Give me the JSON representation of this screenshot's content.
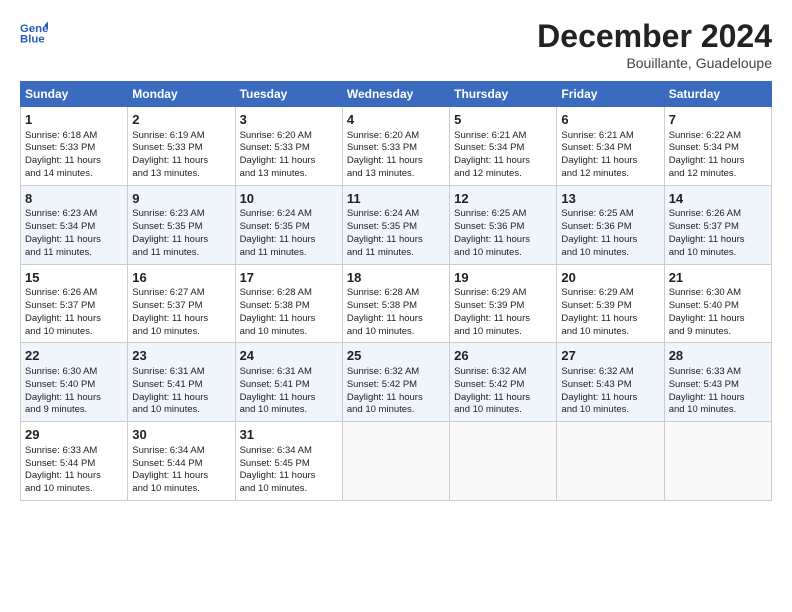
{
  "logo": {
    "line1": "General",
    "line2": "Blue"
  },
  "title": "December 2024",
  "subtitle": "Bouillante, Guadeloupe",
  "days_of_week": [
    "Sunday",
    "Monday",
    "Tuesday",
    "Wednesday",
    "Thursday",
    "Friday",
    "Saturday"
  ],
  "weeks": [
    [
      {
        "day": "1",
        "lines": [
          "Sunrise: 6:18 AM",
          "Sunset: 5:33 PM",
          "Daylight: 11 hours",
          "and 14 minutes."
        ]
      },
      {
        "day": "2",
        "lines": [
          "Sunrise: 6:19 AM",
          "Sunset: 5:33 PM",
          "Daylight: 11 hours",
          "and 13 minutes."
        ]
      },
      {
        "day": "3",
        "lines": [
          "Sunrise: 6:20 AM",
          "Sunset: 5:33 PM",
          "Daylight: 11 hours",
          "and 13 minutes."
        ]
      },
      {
        "day": "4",
        "lines": [
          "Sunrise: 6:20 AM",
          "Sunset: 5:33 PM",
          "Daylight: 11 hours",
          "and 13 minutes."
        ]
      },
      {
        "day": "5",
        "lines": [
          "Sunrise: 6:21 AM",
          "Sunset: 5:34 PM",
          "Daylight: 11 hours",
          "and 12 minutes."
        ]
      },
      {
        "day": "6",
        "lines": [
          "Sunrise: 6:21 AM",
          "Sunset: 5:34 PM",
          "Daylight: 11 hours",
          "and 12 minutes."
        ]
      },
      {
        "day": "7",
        "lines": [
          "Sunrise: 6:22 AM",
          "Sunset: 5:34 PM",
          "Daylight: 11 hours",
          "and 12 minutes."
        ]
      }
    ],
    [
      {
        "day": "8",
        "lines": [
          "Sunrise: 6:23 AM",
          "Sunset: 5:34 PM",
          "Daylight: 11 hours",
          "and 11 minutes."
        ]
      },
      {
        "day": "9",
        "lines": [
          "Sunrise: 6:23 AM",
          "Sunset: 5:35 PM",
          "Daylight: 11 hours",
          "and 11 minutes."
        ]
      },
      {
        "day": "10",
        "lines": [
          "Sunrise: 6:24 AM",
          "Sunset: 5:35 PM",
          "Daylight: 11 hours",
          "and 11 minutes."
        ]
      },
      {
        "day": "11",
        "lines": [
          "Sunrise: 6:24 AM",
          "Sunset: 5:35 PM",
          "Daylight: 11 hours",
          "and 11 minutes."
        ]
      },
      {
        "day": "12",
        "lines": [
          "Sunrise: 6:25 AM",
          "Sunset: 5:36 PM",
          "Daylight: 11 hours",
          "and 10 minutes."
        ]
      },
      {
        "day": "13",
        "lines": [
          "Sunrise: 6:25 AM",
          "Sunset: 5:36 PM",
          "Daylight: 11 hours",
          "and 10 minutes."
        ]
      },
      {
        "day": "14",
        "lines": [
          "Sunrise: 6:26 AM",
          "Sunset: 5:37 PM",
          "Daylight: 11 hours",
          "and 10 minutes."
        ]
      }
    ],
    [
      {
        "day": "15",
        "lines": [
          "Sunrise: 6:26 AM",
          "Sunset: 5:37 PM",
          "Daylight: 11 hours",
          "and 10 minutes."
        ]
      },
      {
        "day": "16",
        "lines": [
          "Sunrise: 6:27 AM",
          "Sunset: 5:37 PM",
          "Daylight: 11 hours",
          "and 10 minutes."
        ]
      },
      {
        "day": "17",
        "lines": [
          "Sunrise: 6:28 AM",
          "Sunset: 5:38 PM",
          "Daylight: 11 hours",
          "and 10 minutes."
        ]
      },
      {
        "day": "18",
        "lines": [
          "Sunrise: 6:28 AM",
          "Sunset: 5:38 PM",
          "Daylight: 11 hours",
          "and 10 minutes."
        ]
      },
      {
        "day": "19",
        "lines": [
          "Sunrise: 6:29 AM",
          "Sunset: 5:39 PM",
          "Daylight: 11 hours",
          "and 10 minutes."
        ]
      },
      {
        "day": "20",
        "lines": [
          "Sunrise: 6:29 AM",
          "Sunset: 5:39 PM",
          "Daylight: 11 hours",
          "and 10 minutes."
        ]
      },
      {
        "day": "21",
        "lines": [
          "Sunrise: 6:30 AM",
          "Sunset: 5:40 PM",
          "Daylight: 11 hours",
          "and 9 minutes."
        ]
      }
    ],
    [
      {
        "day": "22",
        "lines": [
          "Sunrise: 6:30 AM",
          "Sunset: 5:40 PM",
          "Daylight: 11 hours",
          "and 9 minutes."
        ]
      },
      {
        "day": "23",
        "lines": [
          "Sunrise: 6:31 AM",
          "Sunset: 5:41 PM",
          "Daylight: 11 hours",
          "and 10 minutes."
        ]
      },
      {
        "day": "24",
        "lines": [
          "Sunrise: 6:31 AM",
          "Sunset: 5:41 PM",
          "Daylight: 11 hours",
          "and 10 minutes."
        ]
      },
      {
        "day": "25",
        "lines": [
          "Sunrise: 6:32 AM",
          "Sunset: 5:42 PM",
          "Daylight: 11 hours",
          "and 10 minutes."
        ]
      },
      {
        "day": "26",
        "lines": [
          "Sunrise: 6:32 AM",
          "Sunset: 5:42 PM",
          "Daylight: 11 hours",
          "and 10 minutes."
        ]
      },
      {
        "day": "27",
        "lines": [
          "Sunrise: 6:32 AM",
          "Sunset: 5:43 PM",
          "Daylight: 11 hours",
          "and 10 minutes."
        ]
      },
      {
        "day": "28",
        "lines": [
          "Sunrise: 6:33 AM",
          "Sunset: 5:43 PM",
          "Daylight: 11 hours",
          "and 10 minutes."
        ]
      }
    ],
    [
      {
        "day": "29",
        "lines": [
          "Sunrise: 6:33 AM",
          "Sunset: 5:44 PM",
          "Daylight: 11 hours",
          "and 10 minutes."
        ]
      },
      {
        "day": "30",
        "lines": [
          "Sunrise: 6:34 AM",
          "Sunset: 5:44 PM",
          "Daylight: 11 hours",
          "and 10 minutes."
        ]
      },
      {
        "day": "31",
        "lines": [
          "Sunrise: 6:34 AM",
          "Sunset: 5:45 PM",
          "Daylight: 11 hours",
          "and 10 minutes."
        ]
      },
      null,
      null,
      null,
      null
    ]
  ]
}
